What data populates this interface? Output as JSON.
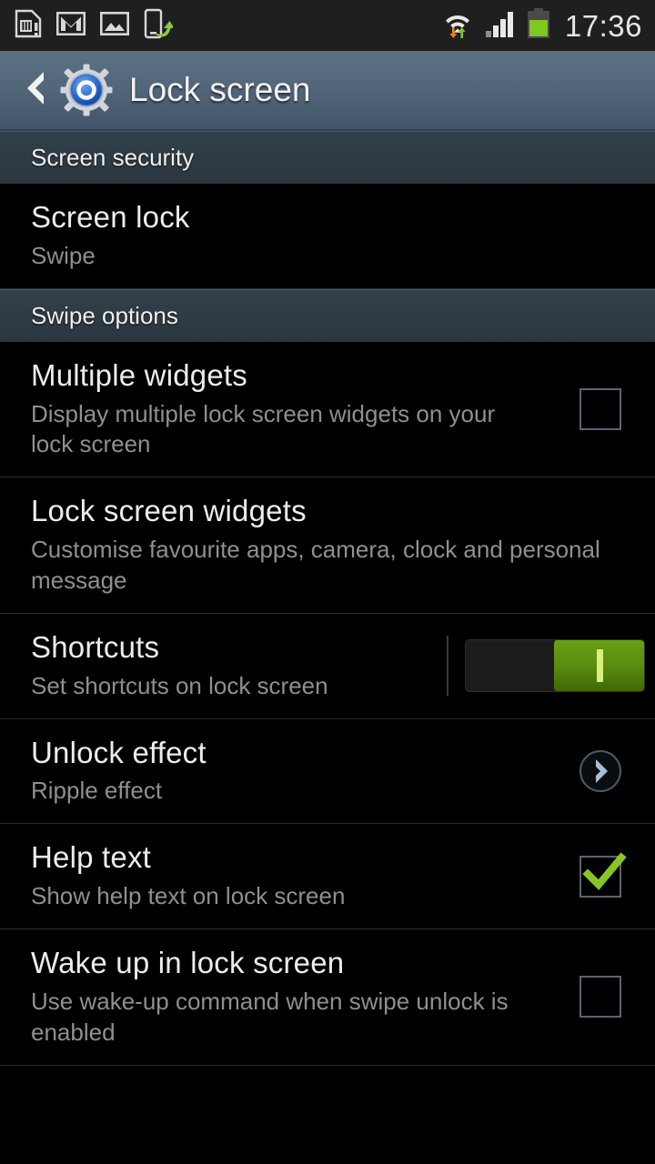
{
  "status_bar": {
    "icons_left": [
      "sim-card-alert-icon",
      "gmail-icon",
      "gallery-image-icon",
      "phone-transfer-icon"
    ],
    "icons_right": [
      "wifi-data-transfer-icon",
      "cellular-signal-icon",
      "battery-icon"
    ],
    "time": "17:36"
  },
  "action_bar": {
    "back_icon": "back-chevron-icon",
    "app_icon": "settings-gear-icon",
    "title": "Lock screen"
  },
  "sections": [
    {
      "header": "Screen security",
      "rows": [
        {
          "title": "Screen lock",
          "summary": "Swipe",
          "widget": "none"
        }
      ]
    },
    {
      "header": "Swipe options",
      "rows": [
        {
          "title": "Multiple widgets",
          "summary": "Display multiple lock screen widgets on your lock screen",
          "widget": "checkbox",
          "checked": false
        },
        {
          "title": "Lock screen widgets",
          "summary": "Customise favourite apps, camera, clock and personal message",
          "widget": "none"
        },
        {
          "title": "Shortcuts",
          "summary": "Set shortcuts on lock screen",
          "widget": "toggle",
          "toggle_state": "on"
        },
        {
          "title": "Unlock effect",
          "summary": "Ripple effect",
          "widget": "chevron",
          "chevron_icon": "chevron-right-icon"
        },
        {
          "title": "Help text",
          "summary": "Show help text on lock screen",
          "widget": "checkbox",
          "checked": true
        },
        {
          "title": "Wake up in lock screen",
          "summary": "Use wake-up command when swipe unlock is enabled",
          "widget": "checkbox",
          "checked": false
        }
      ]
    }
  ],
  "colors": {
    "accent_green": "#86c724",
    "toggle_green": "#5a8c0e",
    "action_bar_blue": "#53677a",
    "section_header": "#2d3b45",
    "background": "#000000",
    "title_text": "#ececec",
    "summary_text": "#8f8f8f"
  }
}
